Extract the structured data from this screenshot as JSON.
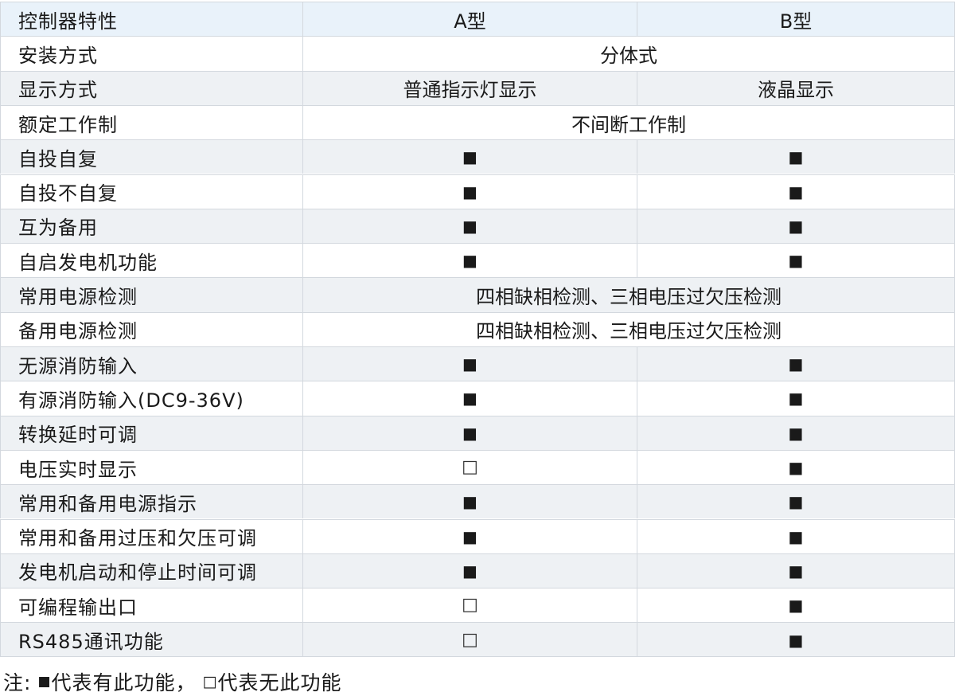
{
  "table": {
    "header": [
      "控制器特性",
      "A型",
      "B型"
    ],
    "rows": [
      {
        "label": "安装方式",
        "span": "分体式"
      },
      {
        "label": "显示方式",
        "a": "普通指示灯显示",
        "b": "液晶显示"
      },
      {
        "label": "额定工作制",
        "span": "不间断工作制"
      },
      {
        "label": "自投自复",
        "a": "■",
        "b": "■"
      },
      {
        "label": "自投不自复",
        "a": "■",
        "b": "■"
      },
      {
        "label": "互为备用",
        "a": "■",
        "b": "■"
      },
      {
        "label": "自启发电机功能",
        "a": "■",
        "b": "■"
      },
      {
        "label": "常用电源检测",
        "span": "四相缺相检测、三相电压过欠压检测"
      },
      {
        "label": "备用电源检测",
        "span": "四相缺相检测、三相电压过欠压检测"
      },
      {
        "label": "无源消防输入",
        "a": "■",
        "b": "■"
      },
      {
        "label": "有源消防输入(DC9-36V)",
        "a": "■",
        "b": "■"
      },
      {
        "label": "转换延时可调",
        "a": "■",
        "b": "■"
      },
      {
        "label": "电压实时显示",
        "a": "□",
        "b": "■"
      },
      {
        "label": "常用和备用电源指示",
        "a": "■",
        "b": "■"
      },
      {
        "label": "常用和备用过压和欠压可调",
        "a": "■",
        "b": "■"
      },
      {
        "label": "发电机启动和停止时间可调",
        "a": "■",
        "b": "■"
      },
      {
        "label": "可编程输出口",
        "a": "□",
        "b": "■"
      },
      {
        "label": "RS485通讯功能",
        "a": "□",
        "b": "■"
      }
    ]
  },
  "note": {
    "prefix": "注:",
    "on_symbol": "■",
    "on_text": "代表有此功能，",
    "off_symbol": "□",
    "off_text": "代表无此功能"
  }
}
